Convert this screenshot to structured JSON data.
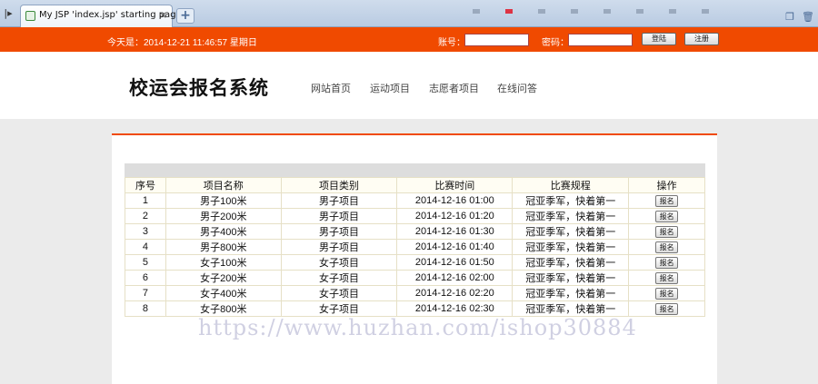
{
  "browser": {
    "tab_title": "My JSP 'index.jsp' starting page",
    "close_glyph": "×",
    "new_tab_glyph": "+",
    "nav_glyph": "|▸"
  },
  "topbar": {
    "date_text": "今天是：2014-12-21 11:46:57 星期日",
    "account_label": "账号：",
    "account_value": "",
    "password_label": "密码：",
    "password_value": "",
    "login_label": "登陆",
    "register_label": "注册",
    "bg_color": "#f04a00"
  },
  "header": {
    "site_title": "校运会报名系统",
    "nav": [
      "网站首页",
      "运动项目",
      "志愿者项目",
      "在线问答"
    ]
  },
  "table": {
    "headers": [
      "序号",
      "项目名称",
      "项目类别",
      "比赛时间",
      "比赛规程",
      "操作"
    ],
    "rows": [
      [
        "1",
        "男子100米",
        "男子项目",
        "2014-12-16 01:00",
        "冠亚季军，快着第一",
        "报名"
      ],
      [
        "2",
        "男子200米",
        "男子项目",
        "2014-12-16 01:20",
        "冠亚季军，快着第一",
        "报名"
      ],
      [
        "3",
        "男子400米",
        "男子项目",
        "2014-12-16 01:30",
        "冠亚季军，快着第一",
        "报名"
      ],
      [
        "4",
        "男子800米",
        "男子项目",
        "2014-12-16 01:40",
        "冠亚季军，快着第一",
        "报名"
      ],
      [
        "5",
        "女子100米",
        "女子项目",
        "2014-12-16 01:50",
        "冠亚季军，快着第一",
        "报名"
      ],
      [
        "6",
        "女子200米",
        "女子项目",
        "2014-12-16 02:00",
        "冠亚季军，快着第一",
        "报名"
      ],
      [
        "7",
        "女子400米",
        "女子项目",
        "2014-12-16 02:20",
        "冠亚季军，快着第一",
        "报名"
      ],
      [
        "8",
        "女子800米",
        "女子项目",
        "2014-12-16 02:30",
        "冠亚季军，快着第一",
        "报名"
      ]
    ]
  },
  "watermark": "https://www.huzhan.com/ishop30884"
}
